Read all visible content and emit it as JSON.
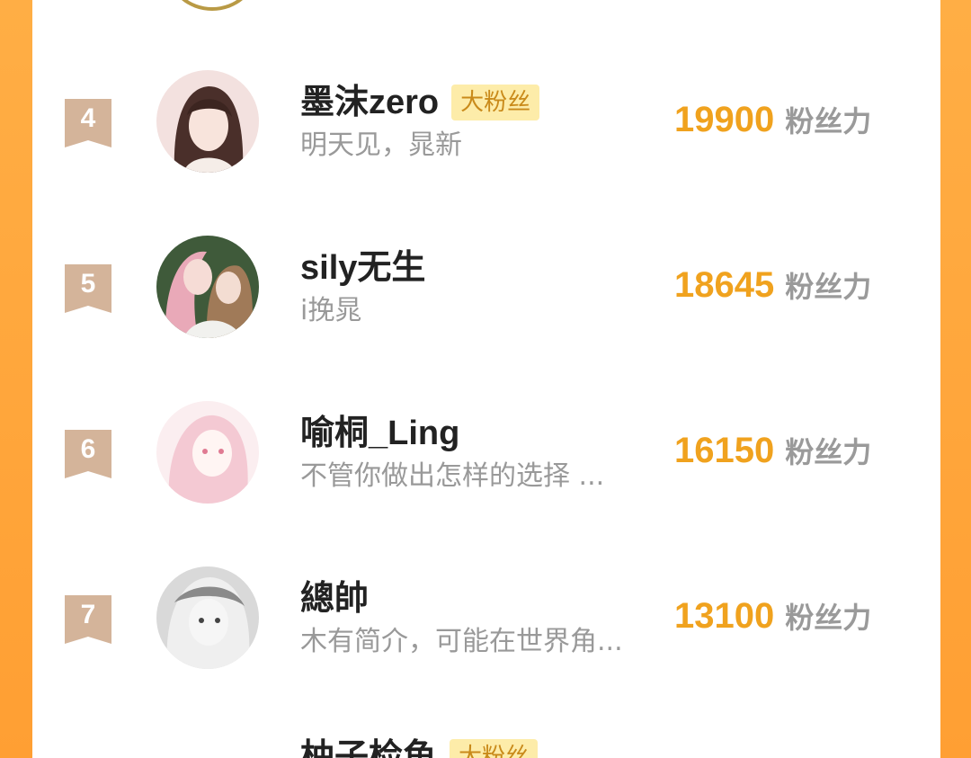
{
  "unit_label": "粉丝力",
  "badge_color": "#d4b49a",
  "accent_color": "#f0a21e",
  "rows": [
    {
      "rank": "4",
      "name": "墨沫zero",
      "tag": "大粉丝",
      "bio": "明天见，晁新",
      "score": "19900",
      "avatar_icon": "girl-dark-hair-avatar"
    },
    {
      "rank": "5",
      "name": "sily无生",
      "tag": "",
      "bio": "i挽晁",
      "score": "18645",
      "avatar_icon": "two-girls-avatar"
    },
    {
      "rank": "6",
      "name": "喻桐_Ling",
      "tag": "",
      "bio": "不管你做出怎样的选择 ...",
      "score": "16150",
      "avatar_icon": "pink-hair-avatar"
    },
    {
      "rank": "7",
      "name": "總帥",
      "tag": "",
      "bio": "木有简介，可能在世界角...",
      "score": "13100",
      "avatar_icon": "monochrome-avatar"
    }
  ],
  "partial_next": {
    "name": "柚子检鱼",
    "tag": "大粉丝"
  }
}
